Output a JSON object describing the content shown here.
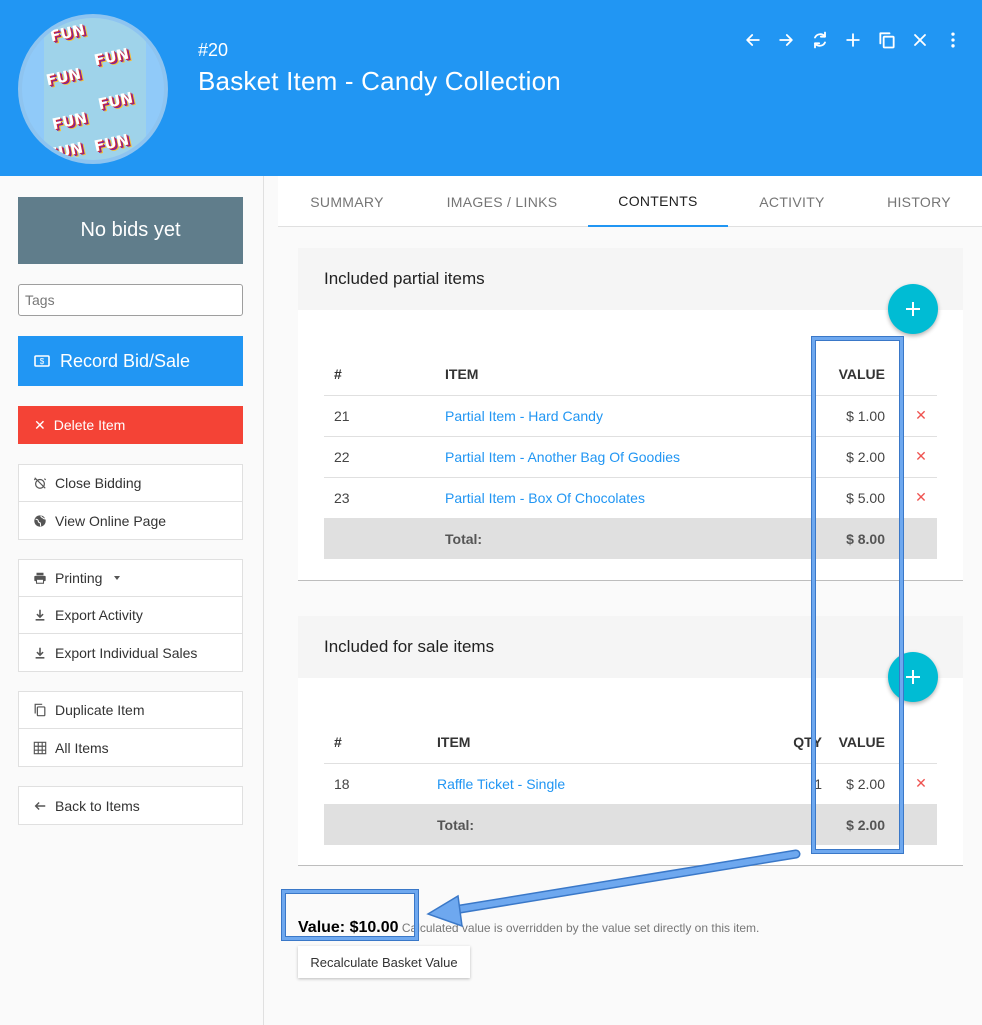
{
  "header": {
    "item_number": "#20",
    "title": "Basket Item - Candy Collection",
    "avatar_text": "FUN",
    "icons": [
      "arrow-left-icon",
      "arrow-right-icon",
      "refresh-icon",
      "plus-icon",
      "copy-icon",
      "close-icon",
      "more-vertical-icon"
    ]
  },
  "sidebar": {
    "bids_status": "No bids yet",
    "tags_placeholder": "Tags",
    "record_label": "Record Bid/Sale",
    "delete_label": "Delete Item",
    "group1": [
      {
        "label": "Close Bidding",
        "icon": "alarm-off-icon"
      },
      {
        "label": "View Online Page",
        "icon": "globe-icon"
      }
    ],
    "group2": [
      {
        "label": "Printing",
        "icon": "printer-icon"
      },
      {
        "label": "Export Activity",
        "icon": "download-icon"
      },
      {
        "label": "Export Individual Sales",
        "icon": "download-icon"
      }
    ],
    "group3": [
      {
        "label": "Duplicate Item",
        "icon": "copy-icon"
      },
      {
        "label": "All Items",
        "icon": "grid-icon"
      }
    ],
    "back_label": "Back to Items"
  },
  "tabs": [
    "SUMMARY",
    "IMAGES / LINKS",
    "CONTENTS",
    "ACTIVITY",
    "HISTORY"
  ],
  "active_tab": "CONTENTS",
  "partial": {
    "title": "Included partial items",
    "headers": {
      "num": "#",
      "item": "ITEM",
      "value": "VALUE"
    },
    "rows": [
      {
        "num": "21",
        "item": "Partial Item - Hard Candy",
        "value": "$ 1.00"
      },
      {
        "num": "22",
        "item": "Partial Item - Another Bag Of Goodies",
        "value": "$ 2.00"
      },
      {
        "num": "23",
        "item": "Partial Item - Box Of Chocolates",
        "value": "$ 5.00"
      }
    ],
    "total_label": "Total:",
    "total_value": "$ 8.00"
  },
  "forsale": {
    "title": "Included for sale items",
    "headers": {
      "num": "#",
      "item": "ITEM",
      "qty": "QTY",
      "value": "VALUE"
    },
    "rows": [
      {
        "num": "18",
        "item": "Raffle Ticket - Single",
        "qty": "1",
        "value": "$ 2.00"
      }
    ],
    "total_label": "Total:",
    "total_value": "$ 2.00"
  },
  "value_summary": {
    "value_label": "Value: $10.00",
    "note": "Calculated value is overridden by the value set directly on this item.",
    "recalc_label": "Recalculate Basket Value"
  },
  "colors": {
    "primary": "#2196f3",
    "danger": "#f44336",
    "fab": "#00bcd4",
    "status_box": "#607d8b",
    "highlight": "#6ea8ef"
  }
}
